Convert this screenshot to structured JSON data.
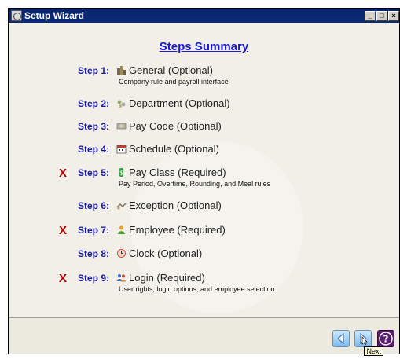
{
  "window": {
    "title": "Setup Wizard"
  },
  "heading": "Steps Summary",
  "steps": [
    {
      "label": "Step 1:",
      "title": "General (Optional)",
      "desc": "Company rule and payroll interface",
      "required": false,
      "icon": "building-icon"
    },
    {
      "label": "Step 2:",
      "title": "Department (Optional)",
      "desc": "",
      "required": false,
      "icon": "department-icon"
    },
    {
      "label": "Step 3:",
      "title": "Pay Code (Optional)",
      "desc": "",
      "required": false,
      "icon": "paycode-icon"
    },
    {
      "label": "Step 4:",
      "title": "Schedule (Optional)",
      "desc": "",
      "required": false,
      "icon": "calendar-icon"
    },
    {
      "label": "Step 5:",
      "title": "Pay Class (Required)",
      "desc": "Pay Period, Overtime, Rounding, and Meal rules",
      "required": true,
      "icon": "money-icon"
    },
    {
      "label": "Step 6:",
      "title": "Exception (Optional)",
      "desc": "",
      "required": false,
      "icon": "exception-icon"
    },
    {
      "label": "Step 7:",
      "title": "Employee (Required)",
      "desc": "",
      "required": true,
      "icon": "employee-icon"
    },
    {
      "label": "Step 8:",
      "title": "Clock (Optional)",
      "desc": "",
      "required": false,
      "icon": "clock-icon"
    },
    {
      "label": "Step 9:",
      "title": "Login (Required)",
      "desc": "User rights, login options, and employee selection",
      "required": true,
      "icon": "users-icon"
    }
  ],
  "required_mark": "X",
  "buttons": {
    "back": "back-arrow-icon",
    "next": "next-arrow-icon",
    "help": "help-icon"
  },
  "tooltip": "Next",
  "colors": {
    "titlebar": "#0a246a",
    "heading": "#1a1ad6",
    "step_label": "#1a1a9e",
    "required_mark": "#b10000"
  }
}
